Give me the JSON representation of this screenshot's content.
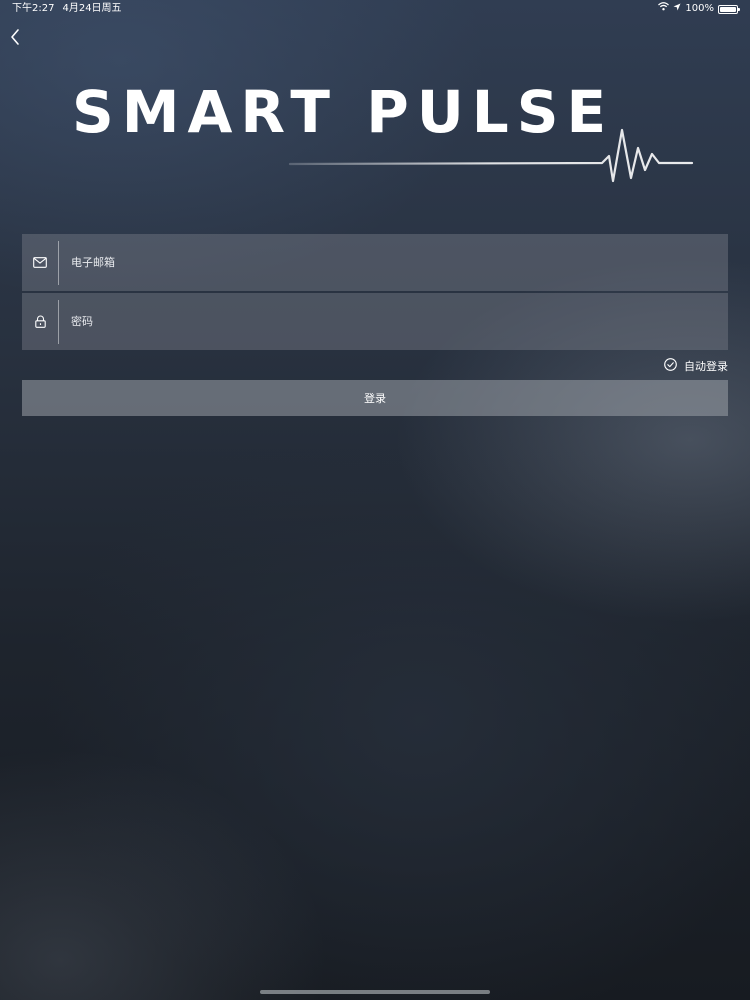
{
  "status_bar": {
    "time": "下午2:27",
    "date": "4月24日周五",
    "battery": "100%",
    "battery_level": 1.0
  },
  "header": {
    "back_icon": "chevron-left-icon"
  },
  "logo": {
    "text": "SMART PULSE"
  },
  "form": {
    "email": {
      "icon": "mail-icon",
      "placeholder": "电子邮箱",
      "value": ""
    },
    "password": {
      "icon": "lock-icon",
      "placeholder": "密码",
      "value": ""
    },
    "auto_login": {
      "icon": "check-circle-icon",
      "label": "自动登录"
    },
    "login_button": {
      "label": "登录"
    }
  },
  "colors": {
    "text": "#ffffff",
    "field_bg": "#5b6069",
    "button_bg": "#7d8189",
    "background_top": "#303d52",
    "background_bottom": "#171b21"
  }
}
